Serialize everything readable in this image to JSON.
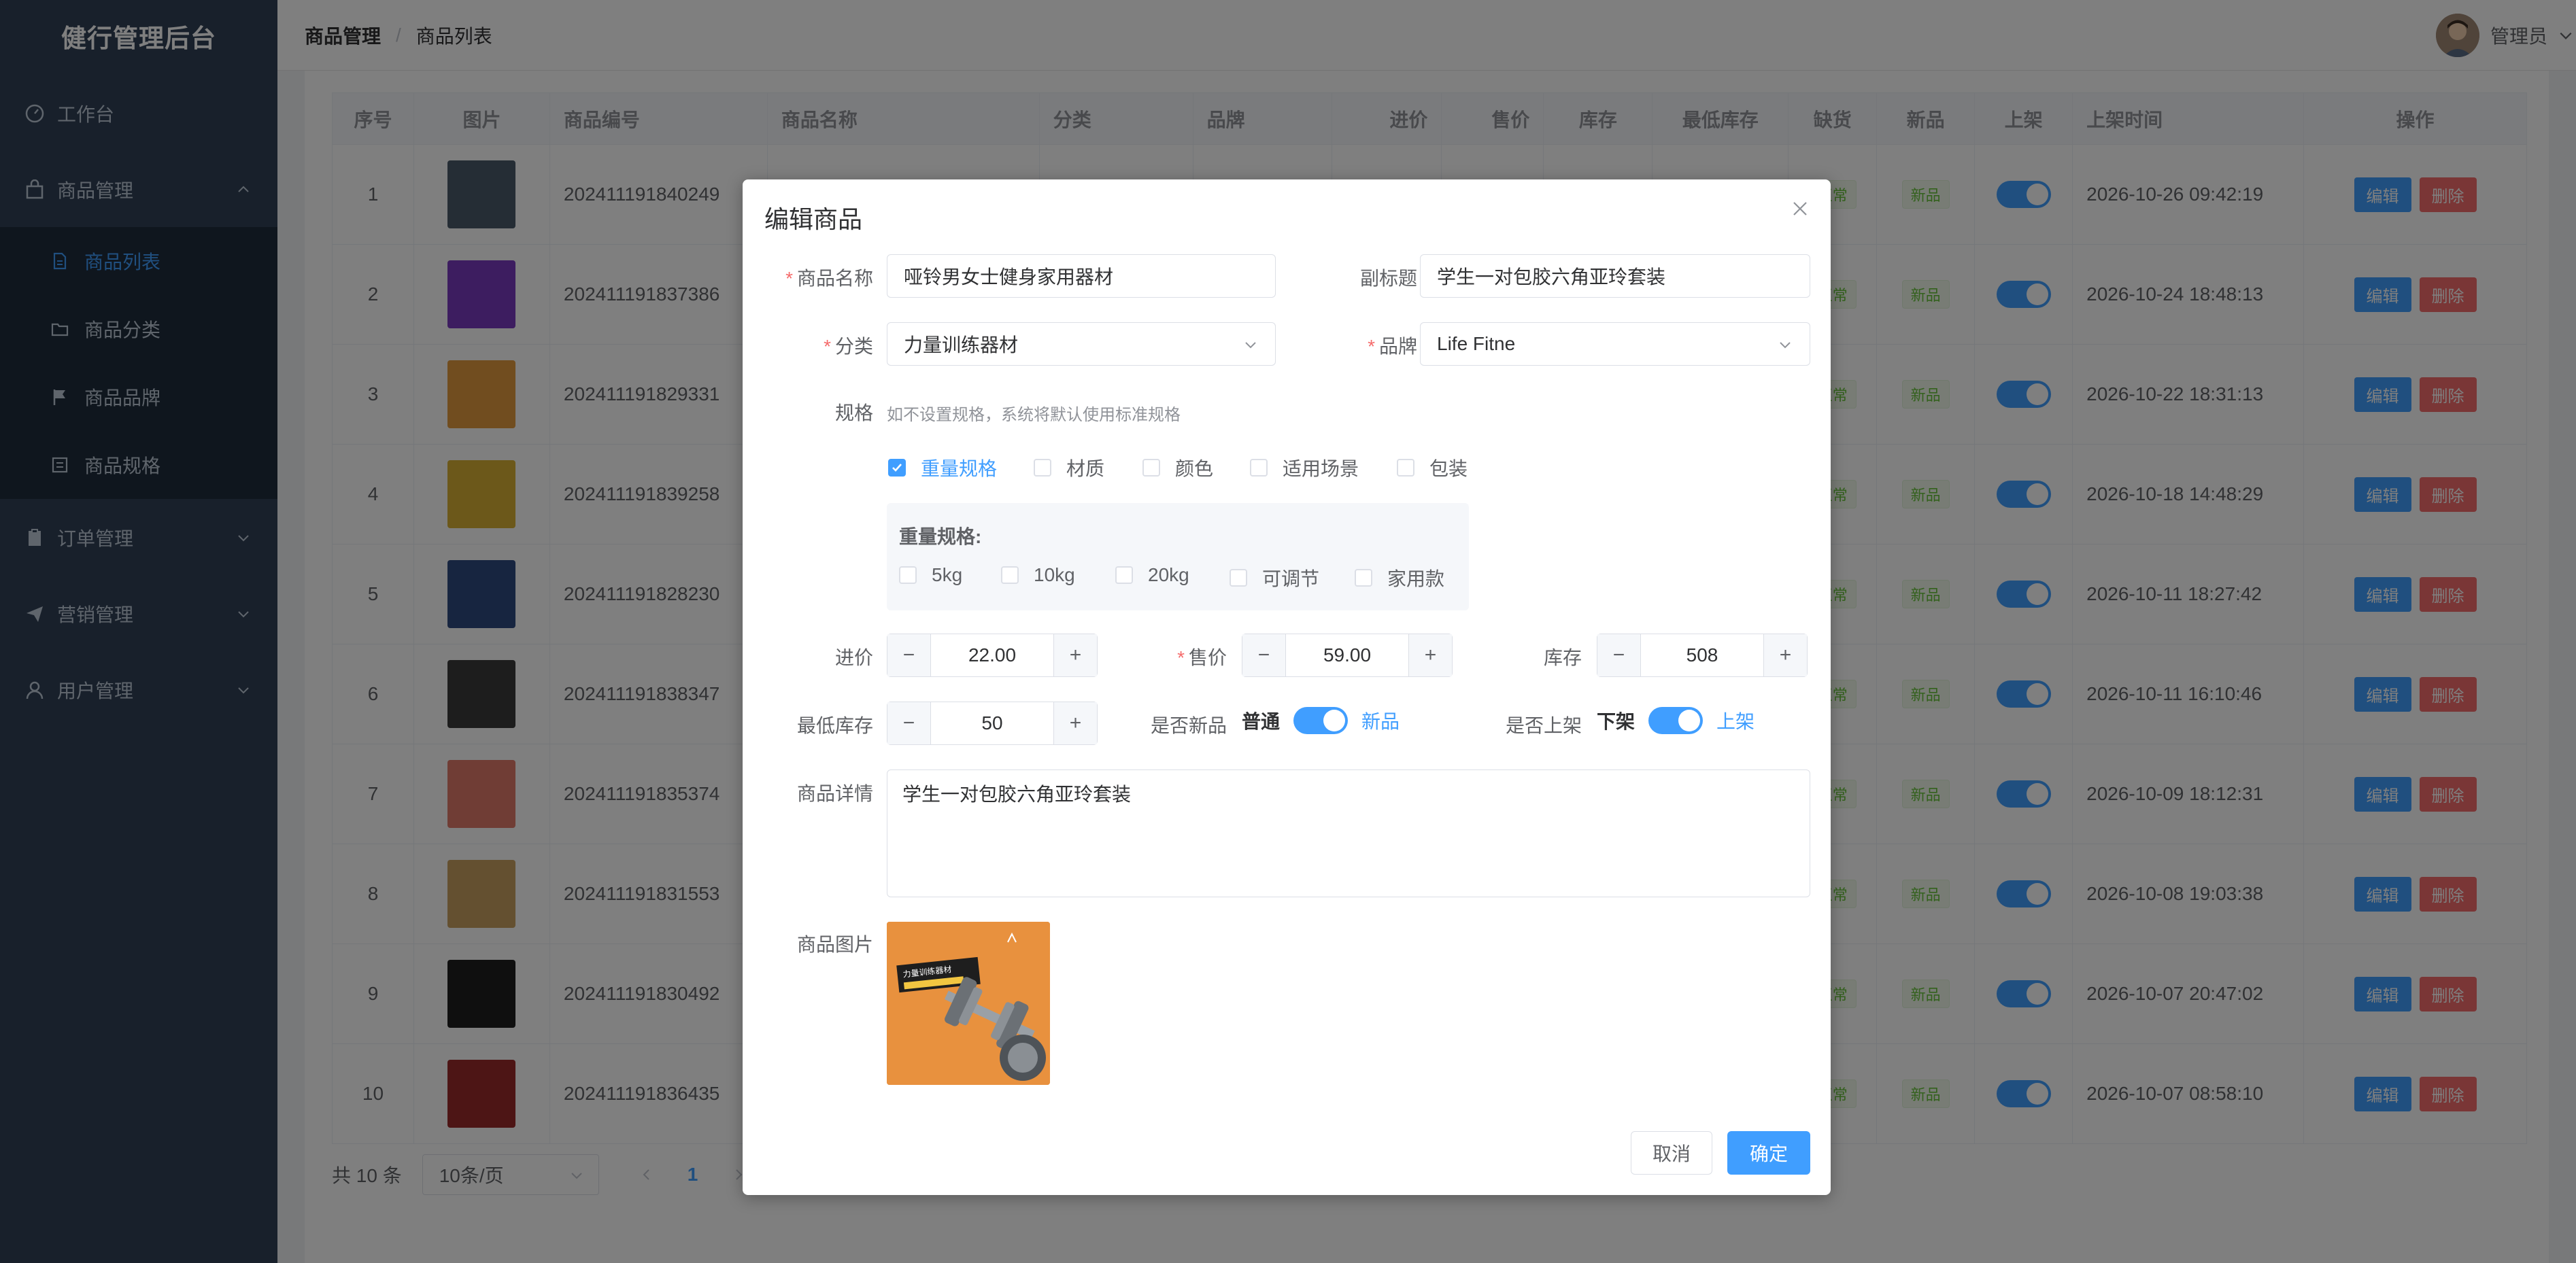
{
  "app": {
    "title": "健行管理后台"
  },
  "sidebar": {
    "items": [
      {
        "label": "工作台"
      },
      {
        "label": "商品管理"
      },
      {
        "label": "订单管理"
      },
      {
        "label": "营销管理"
      },
      {
        "label": "用户管理"
      }
    ],
    "sub_items": [
      {
        "label": "商品列表"
      },
      {
        "label": "商品分类"
      },
      {
        "label": "商品品牌"
      },
      {
        "label": "商品规格"
      }
    ]
  },
  "header": {
    "breadcrumb": [
      "商品管理",
      "商品列表"
    ],
    "separator": "/",
    "user": "管理员"
  },
  "table": {
    "columns": [
      "序号",
      "图片",
      "商品编号",
      "商品名称",
      "分类",
      "品牌",
      "进价",
      "售价",
      "库存",
      "最低库存",
      "缺货",
      "新品",
      "上架",
      "上架时间",
      "操作"
    ],
    "rows": [
      {
        "no": "1",
        "code": "202411191840249",
        "stock_tag": "正常",
        "new_tag": "新品",
        "time": "2026-10-26 09:42:19"
      },
      {
        "no": "2",
        "code": "202411191837386",
        "stock_tag": "正常",
        "new_tag": "新品",
        "time": "2026-10-24 18:48:13"
      },
      {
        "no": "3",
        "code": "202411191829331",
        "stock_tag": "正常",
        "new_tag": "新品",
        "time": "2026-10-22 18:31:13"
      },
      {
        "no": "4",
        "code": "202411191839258",
        "stock_tag": "正常",
        "new_tag": "新品",
        "time": "2026-10-18 14:48:29"
      },
      {
        "no": "5",
        "code": "202411191828230",
        "stock_tag": "正常",
        "new_tag": "新品",
        "time": "2026-10-11 18:27:42"
      },
      {
        "no": "6",
        "code": "202411191838347",
        "stock_tag": "正常",
        "new_tag": "新品",
        "time": "2026-10-11 16:10:46"
      },
      {
        "no": "7",
        "code": "202411191835374",
        "stock_tag": "正常",
        "new_tag": "新品",
        "time": "2026-10-09 18:12:31"
      },
      {
        "no": "8",
        "code": "202411191831553",
        "stock_tag": "正常",
        "new_tag": "新品",
        "time": "2026-10-08 19:03:38"
      },
      {
        "no": "9",
        "code": "202411191830492",
        "stock_tag": "正常",
        "new_tag": "新品",
        "time": "2026-10-07 20:47:02"
      },
      {
        "no": "10",
        "code": "202411191836435",
        "stock_tag": "正常",
        "new_tag": "新品",
        "time": "2026-10-07 08:58:10"
      }
    ],
    "edit_label": "编辑",
    "delete_label": "删除"
  },
  "pager": {
    "total": "共 10 条",
    "page_size": "10条/页",
    "current": "1"
  },
  "dialog": {
    "title": "编辑商品",
    "name_label": "商品名称",
    "name_value": "哑铃男女士健身家用器材",
    "subtitle_label": "副标题",
    "subtitle_value": "学生一对包胶六角亚玲套装",
    "category_label": "分类",
    "category_value": "力量训练器材",
    "brand_label": "品牌",
    "brand_value": "Life Fitne",
    "spec_label": "规格",
    "spec_hint": "如不设置规格，系统将默认使用标准规格",
    "spec_options": [
      "重量规格",
      "材质",
      "颜色",
      "适用场景",
      "包装"
    ],
    "spec_group_title": "重量规格:",
    "spec_values": [
      "5kg",
      "10kg",
      "20kg",
      "可调节",
      "家用款"
    ],
    "cost_label": "进价",
    "cost_value": "22.00",
    "price_label": "售价",
    "price_value": "59.00",
    "stock_label": "库存",
    "stock_value": "508",
    "min_stock_label": "最低库存",
    "min_stock_value": "50",
    "is_new_label": "是否新品",
    "is_new_off": "普通",
    "is_new_on": "新品",
    "on_sale_label": "是否上架",
    "on_sale_off": "下架",
    "on_sale_on": "上架",
    "detail_label": "商品详情",
    "detail_value": "学生一对包胶六角亚玲套装",
    "image_label": "商品图片",
    "image_caption": "力量训练器材",
    "cancel_label": "取消",
    "ok_label": "确定"
  },
  "colors": {
    "primary": "#409eff",
    "sidebar": "#304156",
    "danger": "#f56c6c",
    "success": "#67c23a"
  }
}
